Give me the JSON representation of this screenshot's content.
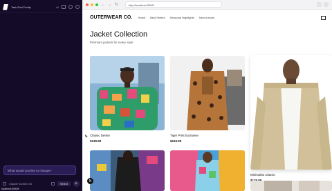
{
  "sidebar": {
    "project_title": "Task Red Firefly",
    "version": "v0",
    "prompt_placeholder": "What would you like to change?",
    "model_label": "Claude Sonnet 4.5",
    "select_label": "Select",
    "status_text": "localhost:3000/#"
  },
  "browser": {
    "url": "http://localhost:3000/"
  },
  "site": {
    "brand": "OUTERWEAR CO.",
    "nav_links": [
      "Home",
      "Best Sellers",
      "Seasonal Highlights",
      "New Arrivals"
    ],
    "title": "Jacket Collection",
    "subtitle": "Premium jackets for every style"
  },
  "products": [
    {
      "name": "Classic Denim",
      "price": "$139.99"
    },
    {
      "name": "Tiger Print Exclusive",
      "price": "$219.99"
    },
    {
      "name": "Minimalist Classic",
      "price": "$129.99"
    }
  ],
  "colors": {
    "panel_bg": "#130b27",
    "prompt_bg": "#2a1d55",
    "traffic_red": "#ff5f57",
    "traffic_yellow": "#febc2e",
    "traffic_green": "#28c840"
  }
}
